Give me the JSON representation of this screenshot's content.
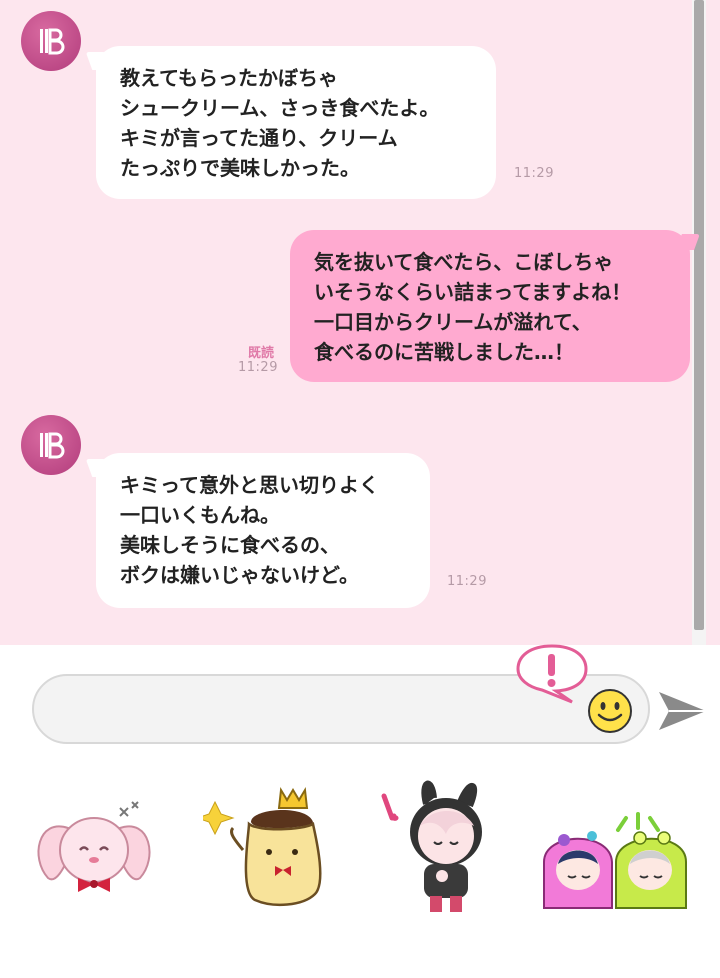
{
  "messages": [
    {
      "direction": "incoming",
      "lines": [
        "教えてもらったかぼちゃ",
        "シュークリーム、さっき食べたよ。",
        "キミが言ってた通り、クリーム",
        "たっぷりで美味しかった。"
      ],
      "time": "11:29"
    },
    {
      "direction": "outgoing",
      "lines": [
        "気を抜いて食べたら、こぼしちゃ",
        "いそうなくらい詰まってますよね！",
        "一口目からクリームが溢れて、",
        "食べるのに苦戦しました…！"
      ],
      "read_label": "既読",
      "time": "11:29"
    },
    {
      "direction": "incoming",
      "lines": [
        "キミって意外と思い切りよく",
        "一口いくもんね。",
        "美味しそうに食べるの、",
        "ボクは嫌いじゃないけど。"
      ],
      "time": "11:29"
    }
  ],
  "composer": {
    "placeholder": ""
  },
  "icons": {
    "avatar": "character-avatar-icon",
    "emoji": "smiley-icon",
    "send": "send-arrow-icon",
    "alert": "exclamation-balloon-icon"
  },
  "stickers": [
    {
      "name": "pink-bunny-sticker"
    },
    {
      "name": "pudding-king-sticker"
    },
    {
      "name": "hooded-character-sticker"
    },
    {
      "name": "sleeping-bag-duo-sticker"
    }
  ],
  "colors": {
    "chat_background": "#fde6ee",
    "incoming_bubble": "#ffffff",
    "outgoing_bubble": "#ffaad0",
    "read_label": "#e07aa8",
    "avatar": "#c04a8a"
  }
}
